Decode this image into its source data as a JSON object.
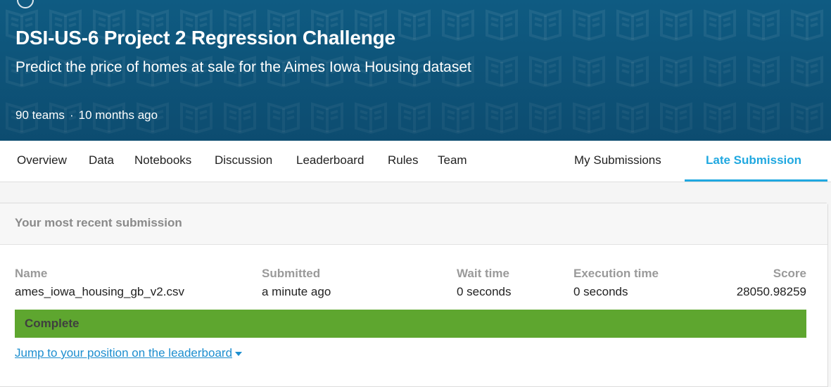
{
  "competition": {
    "title": "DSI-US-6 Project 2 Regression Challenge",
    "subtitle": "Predict the price of homes at sale for the Aimes Iowa Housing dataset",
    "teams": "90 teams",
    "separator": "·",
    "age": "10 months ago"
  },
  "tabs": {
    "overview": "Overview",
    "data": "Data",
    "notebooks": "Notebooks",
    "discussion": "Discussion",
    "leaderboard": "Leaderboard",
    "rules": "Rules",
    "team": "Team",
    "my_submissions": "My Submissions",
    "late_submission": "Late Submission",
    "active": "Late Submission"
  },
  "submission": {
    "header": "Your most recent submission",
    "columns": {
      "name": "Name",
      "submitted": "Submitted",
      "wait_time": "Wait time",
      "execution_time": "Execution time",
      "score": "Score"
    },
    "values": {
      "name": "ames_iowa_housing_gb_v2.csv",
      "submitted": "a minute ago",
      "wait_time": "0 seconds",
      "execution_time": "0 seconds",
      "score": "28050.98259"
    },
    "status": "Complete",
    "jump_link": "Jump to your position on the leaderboard"
  },
  "colors": {
    "banner": "#0f5b82",
    "accent": "#20a8e0",
    "status_complete": "#5ea62f",
    "link": "#1d8ecf"
  },
  "icons": {
    "banner_pattern": "book-icon",
    "link_caret": "caret-down-icon"
  }
}
